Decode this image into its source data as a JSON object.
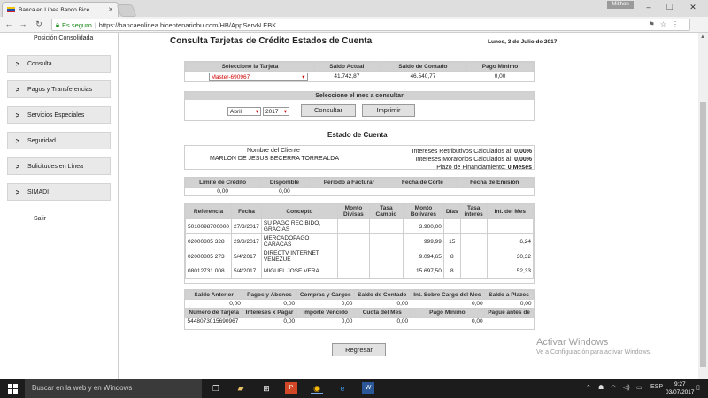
{
  "browser": {
    "tab_title": "Banca en Línea Banco Bice",
    "user_badge": "Milthon",
    "secure_label": "Es seguro",
    "url": "https://bancaenlinea.bicentenariobu.com/HB/AppServN.EBK"
  },
  "sidebar": {
    "top_item": "Posición Consolidada",
    "items": [
      {
        "label": "Consulta"
      },
      {
        "label": "Pagos y Transferencias"
      },
      {
        "label": "Servicios Especiales"
      },
      {
        "label": "Seguridad"
      },
      {
        "label": "Solicitudes en Línea"
      },
      {
        "label": "SIMADI"
      }
    ],
    "exit": "Salir"
  },
  "page": {
    "title": "Consulta Tarjetas de Crédito Estados de Cuenta",
    "date": "Lunes, 3 de Julio de 2017"
  },
  "card_select": {
    "headers": [
      "Seleccione la Tarjeta",
      "Saldo Actual",
      "Saldo de Contado",
      "Pago Mínimo"
    ],
    "selected_card": "Master-690967",
    "saldo_actual": "41.742,87",
    "saldo_contado": "46.540,77",
    "pago_minimo": "0,00"
  },
  "month_select": {
    "header": "Seleccione el mes a consultar",
    "month": "Abril",
    "year": "2017",
    "consultar": "Consultar",
    "imprimir": "Imprimir"
  },
  "estado": {
    "title": "Estado de Cuenta",
    "client_label": "Nombre del Cliente",
    "client_name": "MARLON DE JESUS BECERRA TORREALDA",
    "info": [
      {
        "label": "Intereses Retributivos Calculados al:",
        "value": "0,00%"
      },
      {
        "label": "Intereses Moratorios Calculados al:",
        "value": "0,00%"
      },
      {
        "label": "Plazo de Financiamiento:",
        "value": "0 Meses"
      }
    ]
  },
  "limits": {
    "headers": [
      "Límite de Crédito",
      "Disponible",
      "Período a Facturar",
      "Fecha de Corte",
      "Fecha de Emisión"
    ],
    "values": [
      "0,00",
      "0,00",
      "",
      "",
      ""
    ]
  },
  "movements": {
    "headers": [
      "Referencia",
      "Fecha",
      "Concepto",
      "Monto Divisas",
      "Tasa Cambio",
      "Monto Bolívares",
      "Días",
      "Tasa interes",
      "Int. del Mes"
    ],
    "rows": [
      [
        "5010098700000",
        "27/3/2017",
        "SU PAGO RECIBIDO, GRACIAS",
        "",
        "",
        "3.900,00",
        "",
        "",
        ""
      ],
      [
        "02000805 328",
        "29/3/2017",
        "MERCADOPAGO CARACAS",
        "",
        "",
        "999,99",
        "15",
        "",
        "6,24"
      ],
      [
        "02000805 273",
        "5/4/2017",
        "DIRECTV INTERNET VENEZUE",
        "",
        "",
        "9.094,65",
        "8",
        "",
        "30,32"
      ],
      [
        "08012731 008",
        "5/4/2017",
        "MIGUEL JOSE VERA",
        "",
        "",
        "15.697,50",
        "8",
        "",
        "52,33"
      ]
    ]
  },
  "summary": {
    "headers1": [
      "Saldo Anterior",
      "Pagos y Abonos",
      "Compras y Cargos",
      "Saldo de Contado",
      "Int. Sobre Cargo del Mes",
      "Saldo a Plazos"
    ],
    "values1": [
      "0,00",
      "0,00",
      "0,00",
      "0,00",
      "0,00",
      "0,00"
    ],
    "headers2": [
      "Número de Tarjeta",
      "Intereses x Pagar",
      "Importe Vencido",
      "Cuota del Mes",
      "Pago Mínimo",
      "Pague antes de"
    ],
    "values2": [
      "5448073015690967",
      "0,00",
      "0,00",
      "0,00",
      "0,00",
      ""
    ]
  },
  "regresar": "Regresar",
  "watermark": {
    "line1": "Activar Windows",
    "line2": "Ve a Configuración para activar Windows."
  },
  "taskbar": {
    "search": "Buscar en la web y en Windows",
    "lang": "ESP",
    "time": "9:27",
    "date": "03/07/2017"
  }
}
